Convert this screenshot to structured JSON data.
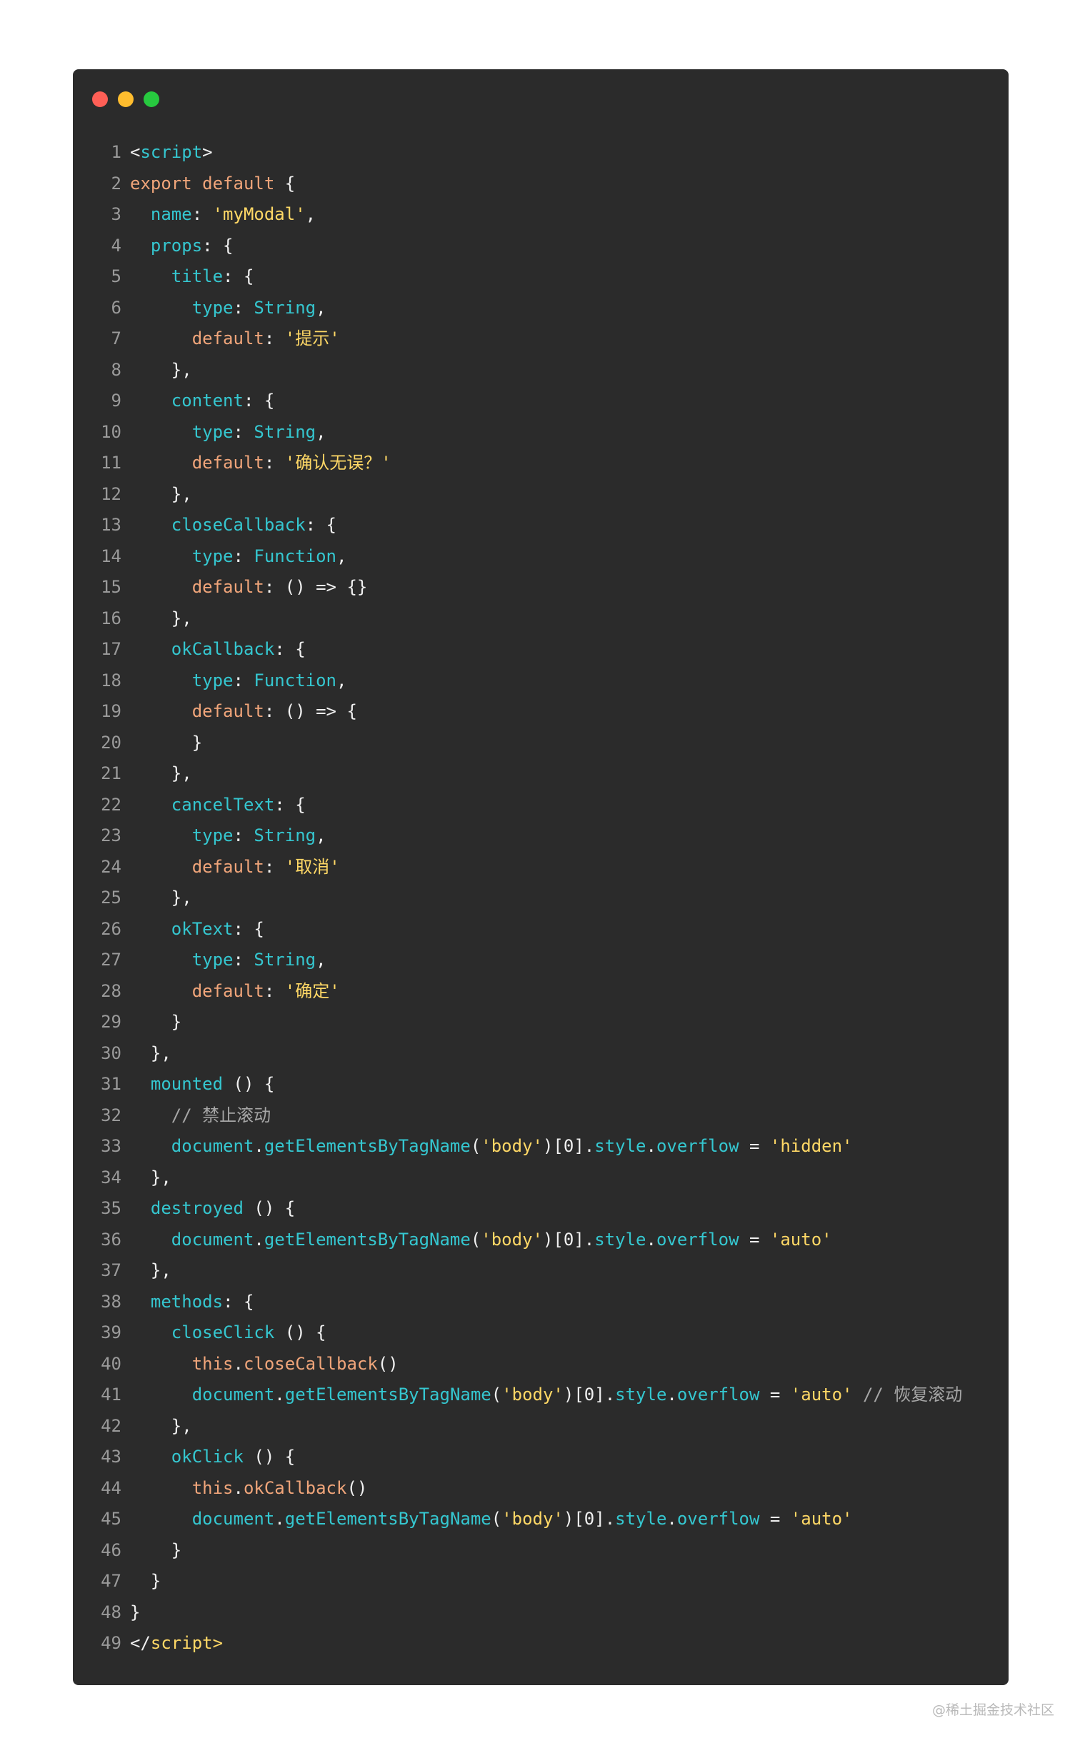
{
  "window": {
    "traffic_lights": [
      "#ff5f56",
      "#ffbd2e",
      "#27c93f"
    ]
  },
  "code_lines": [
    {
      "n": "1",
      "tokens": [
        [
          "t",
          "<"
        ],
        [
          "p",
          "script"
        ],
        [
          "t",
          ">"
        ]
      ]
    },
    {
      "n": "2",
      "tokens": [
        [
          "k",
          "export default"
        ],
        [
          "t",
          " {"
        ]
      ]
    },
    {
      "n": "3",
      "tokens": [
        [
          "t",
          "  "
        ],
        [
          "p",
          "name"
        ],
        [
          "t",
          ": "
        ],
        [
          "s",
          "'myModal'"
        ],
        [
          "t",
          ","
        ]
      ]
    },
    {
      "n": "4",
      "tokens": [
        [
          "t",
          "  "
        ],
        [
          "p",
          "props"
        ],
        [
          "t",
          ": {"
        ]
      ]
    },
    {
      "n": "5",
      "tokens": [
        [
          "t",
          "    "
        ],
        [
          "p",
          "title"
        ],
        [
          "t",
          ": {"
        ]
      ]
    },
    {
      "n": "6",
      "tokens": [
        [
          "t",
          "      "
        ],
        [
          "p",
          "type"
        ],
        [
          "t",
          ": "
        ],
        [
          "p",
          "String"
        ],
        [
          "t",
          ","
        ]
      ]
    },
    {
      "n": "7",
      "tokens": [
        [
          "t",
          "      "
        ],
        [
          "k",
          "default"
        ],
        [
          "t",
          ": "
        ],
        [
          "s",
          "'提示'"
        ]
      ]
    },
    {
      "n": "8",
      "tokens": [
        [
          "t",
          "    },"
        ]
      ]
    },
    {
      "n": "9",
      "tokens": [
        [
          "t",
          "    "
        ],
        [
          "p",
          "content"
        ],
        [
          "t",
          ": {"
        ]
      ]
    },
    {
      "n": "10",
      "tokens": [
        [
          "t",
          "      "
        ],
        [
          "p",
          "type"
        ],
        [
          "t",
          ": "
        ],
        [
          "p",
          "String"
        ],
        [
          "t",
          ","
        ]
      ]
    },
    {
      "n": "11",
      "tokens": [
        [
          "t",
          "      "
        ],
        [
          "k",
          "default"
        ],
        [
          "t",
          ": "
        ],
        [
          "s",
          "'确认无误？'"
        ]
      ]
    },
    {
      "n": "12",
      "tokens": [
        [
          "t",
          "    },"
        ]
      ]
    },
    {
      "n": "13",
      "tokens": [
        [
          "t",
          "    "
        ],
        [
          "p",
          "closeCallback"
        ],
        [
          "t",
          ": {"
        ]
      ]
    },
    {
      "n": "14",
      "tokens": [
        [
          "t",
          "      "
        ],
        [
          "p",
          "type"
        ],
        [
          "t",
          ": "
        ],
        [
          "p",
          "Function"
        ],
        [
          "t",
          ","
        ]
      ]
    },
    {
      "n": "15",
      "tokens": [
        [
          "t",
          "      "
        ],
        [
          "k",
          "default"
        ],
        [
          "t",
          ": () => {}"
        ]
      ]
    },
    {
      "n": "16",
      "tokens": [
        [
          "t",
          "    },"
        ]
      ]
    },
    {
      "n": "17",
      "tokens": [
        [
          "t",
          "    "
        ],
        [
          "p",
          "okCallback"
        ],
        [
          "t",
          ": {"
        ]
      ]
    },
    {
      "n": "18",
      "tokens": [
        [
          "t",
          "      "
        ],
        [
          "p",
          "type"
        ],
        [
          "t",
          ": "
        ],
        [
          "p",
          "Function"
        ],
        [
          "t",
          ","
        ]
      ]
    },
    {
      "n": "19",
      "tokens": [
        [
          "t",
          "      "
        ],
        [
          "k",
          "default"
        ],
        [
          "t",
          ": () => {"
        ]
      ]
    },
    {
      "n": "20",
      "tokens": [
        [
          "t",
          "      }"
        ]
      ]
    },
    {
      "n": "21",
      "tokens": [
        [
          "t",
          "    },"
        ]
      ]
    },
    {
      "n": "22",
      "tokens": [
        [
          "t",
          "    "
        ],
        [
          "p",
          "cancelText"
        ],
        [
          "t",
          ": {"
        ]
      ]
    },
    {
      "n": "23",
      "tokens": [
        [
          "t",
          "      "
        ],
        [
          "p",
          "type"
        ],
        [
          "t",
          ": "
        ],
        [
          "p",
          "String"
        ],
        [
          "t",
          ","
        ]
      ]
    },
    {
      "n": "24",
      "tokens": [
        [
          "t",
          "      "
        ],
        [
          "k",
          "default"
        ],
        [
          "t",
          ": "
        ],
        [
          "s",
          "'取消'"
        ]
      ]
    },
    {
      "n": "25",
      "tokens": [
        [
          "t",
          "    },"
        ]
      ]
    },
    {
      "n": "26",
      "tokens": [
        [
          "t",
          "    "
        ],
        [
          "p",
          "okText"
        ],
        [
          "t",
          ": {"
        ]
      ]
    },
    {
      "n": "27",
      "tokens": [
        [
          "t",
          "      "
        ],
        [
          "p",
          "type"
        ],
        [
          "t",
          ": "
        ],
        [
          "p",
          "String"
        ],
        [
          "t",
          ","
        ]
      ]
    },
    {
      "n": "28",
      "tokens": [
        [
          "t",
          "      "
        ],
        [
          "k",
          "default"
        ],
        [
          "t",
          ": "
        ],
        [
          "s",
          "'确定'"
        ]
      ]
    },
    {
      "n": "29",
      "tokens": [
        [
          "t",
          "    }"
        ]
      ]
    },
    {
      "n": "30",
      "tokens": [
        [
          "t",
          "  },"
        ]
      ]
    },
    {
      "n": "31",
      "tokens": [
        [
          "t",
          "  "
        ],
        [
          "p",
          "mounted"
        ],
        [
          "t",
          " () {"
        ]
      ]
    },
    {
      "n": "32",
      "tokens": [
        [
          "t",
          "    "
        ],
        [
          "c",
          "// 禁止滚动"
        ]
      ]
    },
    {
      "n": "33",
      "tokens": [
        [
          "t",
          "    "
        ],
        [
          "p",
          "document"
        ],
        [
          "t",
          "."
        ],
        [
          "p",
          "getElementsByTagName"
        ],
        [
          "t",
          "("
        ],
        [
          "s",
          "'body'"
        ],
        [
          "t",
          ")[0]."
        ],
        [
          "p",
          "style"
        ],
        [
          "t",
          "."
        ],
        [
          "p",
          "overflow"
        ],
        [
          "t",
          " = "
        ],
        [
          "s",
          "'hidden'"
        ]
      ]
    },
    {
      "n": "34",
      "tokens": [
        [
          "t",
          "  },"
        ]
      ]
    },
    {
      "n": "35",
      "tokens": [
        [
          "t",
          "  "
        ],
        [
          "p",
          "destroyed"
        ],
        [
          "t",
          " () {"
        ]
      ]
    },
    {
      "n": "36",
      "tokens": [
        [
          "t",
          "    "
        ],
        [
          "p",
          "document"
        ],
        [
          "t",
          "."
        ],
        [
          "p",
          "getElementsByTagName"
        ],
        [
          "t",
          "("
        ],
        [
          "s",
          "'body'"
        ],
        [
          "t",
          ")[0]."
        ],
        [
          "p",
          "style"
        ],
        [
          "t",
          "."
        ],
        [
          "p",
          "overflow"
        ],
        [
          "t",
          " = "
        ],
        [
          "s",
          "'auto'"
        ]
      ]
    },
    {
      "n": "37",
      "tokens": [
        [
          "t",
          "  },"
        ]
      ]
    },
    {
      "n": "38",
      "tokens": [
        [
          "t",
          "  "
        ],
        [
          "p",
          "methods"
        ],
        [
          "t",
          ": {"
        ]
      ]
    },
    {
      "n": "39",
      "tokens": [
        [
          "t",
          "    "
        ],
        [
          "p",
          "closeClick"
        ],
        [
          "t",
          " () {"
        ]
      ]
    },
    {
      "n": "40",
      "tokens": [
        [
          "t",
          "      "
        ],
        [
          "k",
          "this"
        ],
        [
          "t",
          "."
        ],
        [
          "k",
          "closeCallback"
        ],
        [
          "t",
          "()"
        ]
      ]
    },
    {
      "n": "41",
      "tokens": [
        [
          "t",
          "      "
        ],
        [
          "p",
          "document"
        ],
        [
          "t",
          "."
        ],
        [
          "p",
          "getElementsByTagName"
        ],
        [
          "t",
          "("
        ],
        [
          "s",
          "'body'"
        ],
        [
          "t",
          ")[0]."
        ],
        [
          "p",
          "style"
        ],
        [
          "t",
          "."
        ],
        [
          "p",
          "overflow"
        ],
        [
          "t",
          " = "
        ],
        [
          "s",
          "'auto'"
        ],
        [
          "t",
          " "
        ],
        [
          "c",
          "// 恢复滚动"
        ]
      ]
    },
    {
      "n": "42",
      "tokens": [
        [
          "t",
          "    },"
        ]
      ]
    },
    {
      "n": "43",
      "tokens": [
        [
          "t",
          "    "
        ],
        [
          "p",
          "okClick"
        ],
        [
          "t",
          " () {"
        ]
      ]
    },
    {
      "n": "44",
      "tokens": [
        [
          "t",
          "      "
        ],
        [
          "k",
          "this"
        ],
        [
          "t",
          "."
        ],
        [
          "k",
          "okCallback"
        ],
        [
          "t",
          "()"
        ]
      ]
    },
    {
      "n": "45",
      "tokens": [
        [
          "t",
          "      "
        ],
        [
          "p",
          "document"
        ],
        [
          "t",
          "."
        ],
        [
          "p",
          "getElementsByTagName"
        ],
        [
          "t",
          "("
        ],
        [
          "s",
          "'body'"
        ],
        [
          "t",
          ")[0]."
        ],
        [
          "p",
          "style"
        ],
        [
          "t",
          "."
        ],
        [
          "p",
          "overflow"
        ],
        [
          "t",
          " = "
        ],
        [
          "s",
          "'auto'"
        ]
      ]
    },
    {
      "n": "46",
      "tokens": [
        [
          "t",
          "    }"
        ]
      ]
    },
    {
      "n": "47",
      "tokens": [
        [
          "t",
          "  }"
        ]
      ]
    },
    {
      "n": "48",
      "tokens": [
        [
          "t",
          "}"
        ]
      ]
    },
    {
      "n": "49",
      "tokens": [
        [
          "t",
          "</"
        ],
        [
          "s",
          "script"
        ],
        [
          "s",
          ">"
        ]
      ]
    }
  ],
  "watermark": "@稀土掘金技术社区"
}
